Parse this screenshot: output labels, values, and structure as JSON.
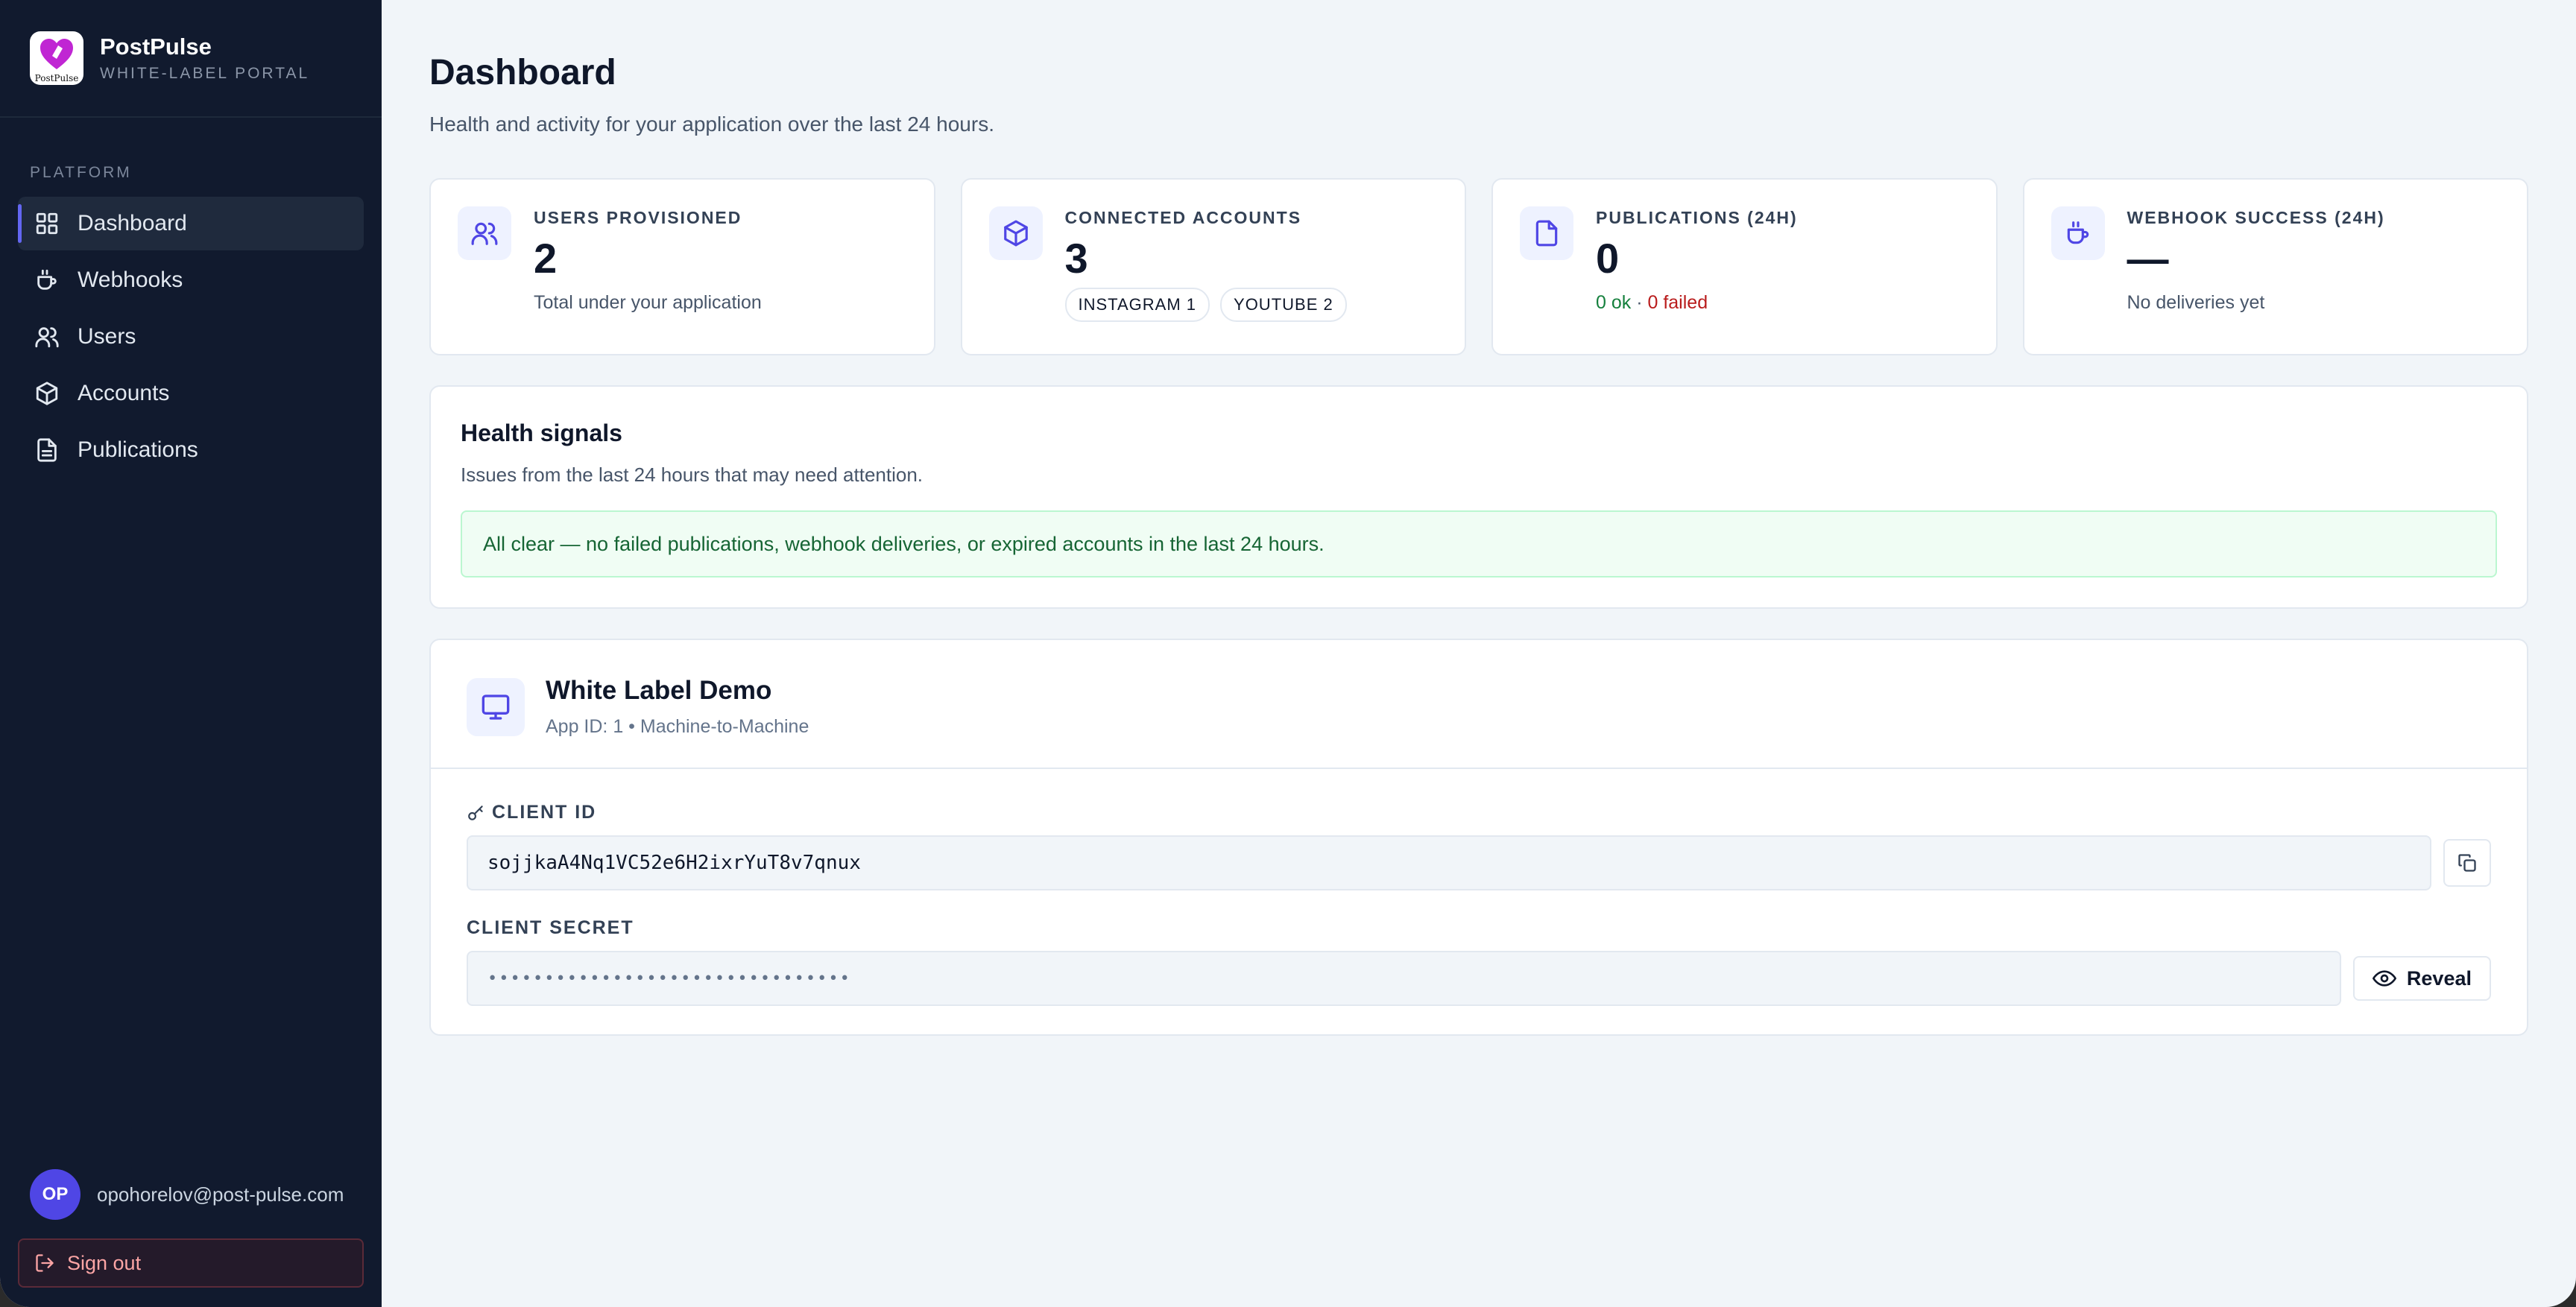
{
  "brand": {
    "name": "PostPulse",
    "subtitle": "WHITE-LABEL PORTAL",
    "logo_text": "PostPulse"
  },
  "sidebar": {
    "section": "PLATFORM",
    "items": [
      {
        "label": "Dashboard",
        "icon": "grid-icon",
        "active": true
      },
      {
        "label": "Webhooks",
        "icon": "cup-icon"
      },
      {
        "label": "Users",
        "icon": "users-icon"
      },
      {
        "label": "Accounts",
        "icon": "cube-icon"
      },
      {
        "label": "Publications",
        "icon": "document-icon"
      }
    ],
    "user": {
      "initials": "OP",
      "email": "opohorelov@post-pulse.com"
    },
    "signout": "Sign out"
  },
  "header": {
    "title": "Dashboard",
    "subtitle": "Health and activity for your application over the last 24 hours."
  },
  "stats": [
    {
      "label": "USERS PROVISIONED",
      "value": "2",
      "foot": "Total under your application"
    },
    {
      "label": "CONNECTED ACCOUNTS",
      "value": "3",
      "chips": [
        "INSTAGRAM 1",
        "YOUTUBE 2"
      ]
    },
    {
      "label": "PUBLICATIONS (24H)",
      "value": "0",
      "ok": "0 ok",
      "sep": " · ",
      "failed": "0 failed"
    },
    {
      "label": "WEBHOOK SUCCESS (24H)",
      "value": "—",
      "foot": "No deliveries yet"
    }
  ],
  "health": {
    "title": "Health signals",
    "subtitle": "Issues from the last 24 hours that may need attention.",
    "message": "All clear — no failed publications, webhook deliveries, or expired accounts in the last 24 hours."
  },
  "app": {
    "name": "White Label Demo",
    "meta": "App ID: 1 • Machine-to-Machine",
    "client_id_label": "CLIENT ID",
    "client_id": "sojjkaA4Nq1VC52e6H2ixrYuT8v7qnux",
    "client_secret_label": "CLIENT SECRET",
    "client_secret": "••••••••••••••••••••••••••••••••",
    "reveal": "Reveal"
  },
  "colors": {
    "accent": "#4f46e5",
    "sidebar_bg": "#111a2e",
    "ok": "#15803d",
    "failed": "#b91c1c"
  }
}
